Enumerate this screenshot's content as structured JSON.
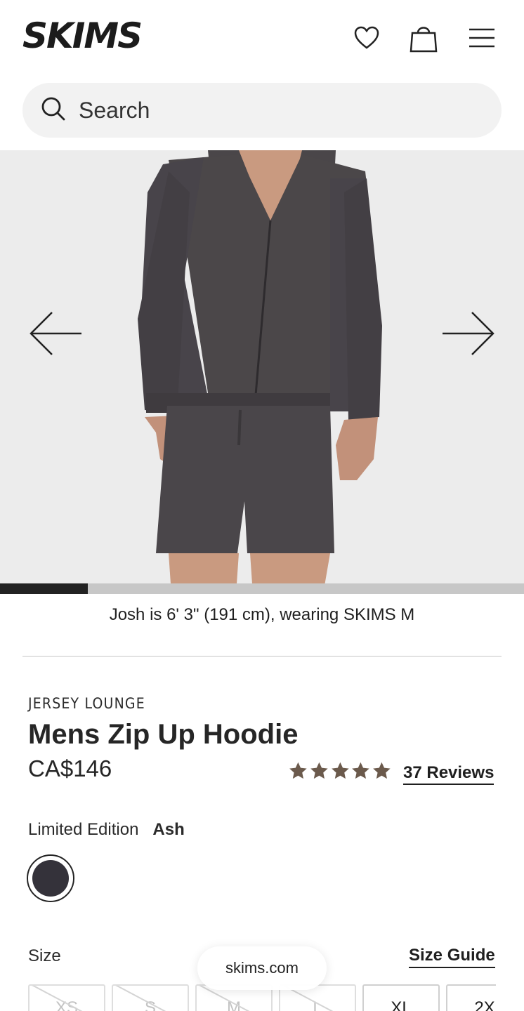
{
  "header": {
    "logo_text": "SKIMS",
    "icons": [
      "heart-icon",
      "bag-icon",
      "hamburger-menu-icon"
    ]
  },
  "search": {
    "placeholder": "Search"
  },
  "gallery": {
    "progress_fraction": 0.167,
    "caption": "Josh is 6' 3\" (191 cm), wearing SKIMS M"
  },
  "product": {
    "collection": "JERSEY LOUNGE",
    "title": "Mens Zip Up Hoodie",
    "price": "CA$146",
    "rating": 5,
    "reviews_label": "37 Reviews",
    "color_label": "Limited Edition",
    "color_name": "Ash",
    "swatch_color": "#34323a",
    "size_label": "Size",
    "size_guide_label": "Size Guide",
    "sizes": [
      {
        "label": "XS",
        "available": false
      },
      {
        "label": "S",
        "available": false
      },
      {
        "label": "M",
        "available": false
      },
      {
        "label": "L",
        "available": false
      },
      {
        "label": "XL",
        "available": true
      },
      {
        "label": "2X",
        "available": true
      }
    ]
  },
  "browser": {
    "url": "skims.com"
  },
  "colors": {
    "star": "#6b5a4c",
    "accent": "#1f1f1f"
  }
}
